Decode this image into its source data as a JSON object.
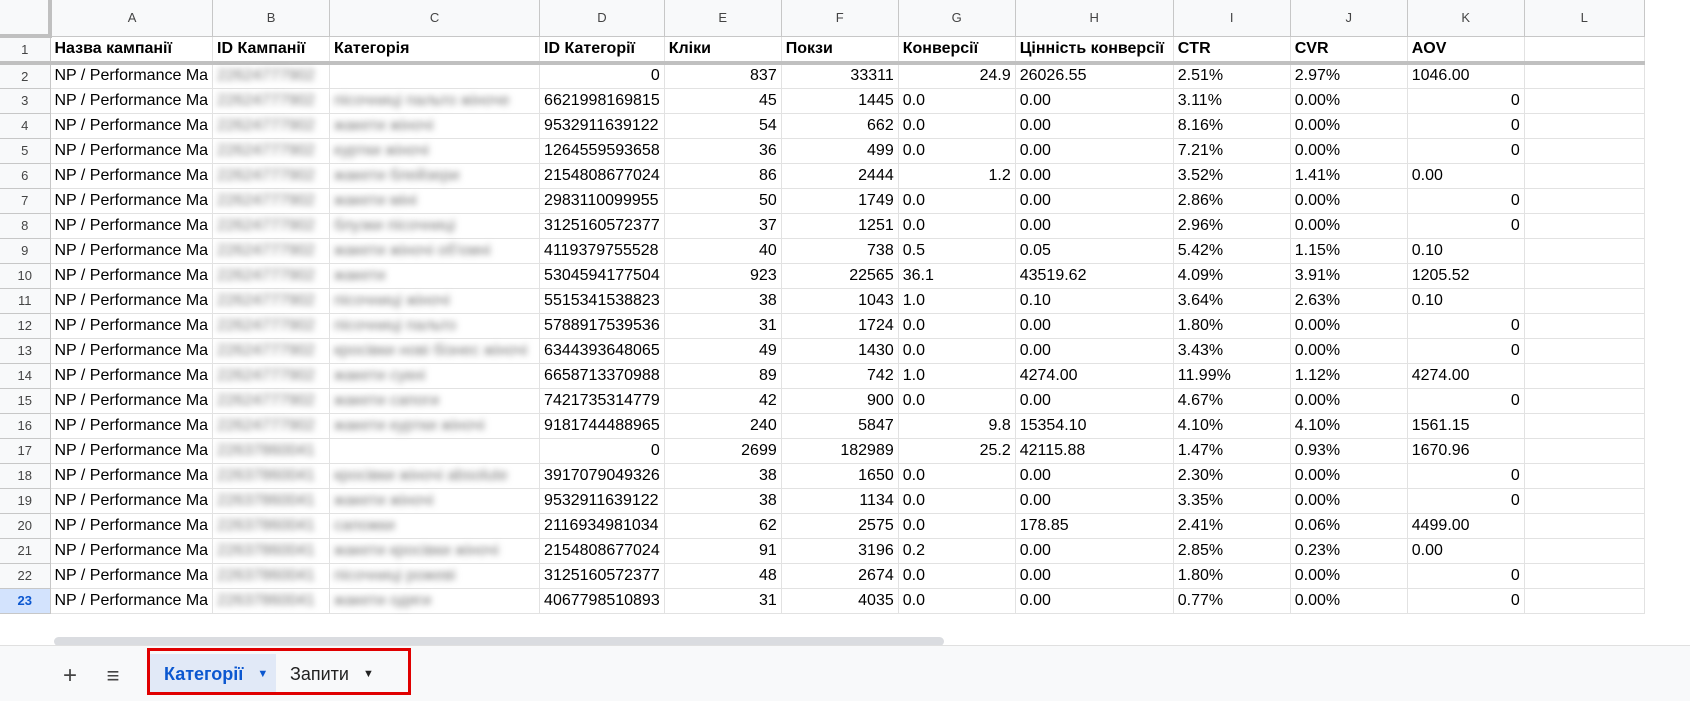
{
  "columns": [
    "A",
    "B",
    "C",
    "D",
    "E",
    "F",
    "G",
    "H",
    "I",
    "J",
    "K",
    "L"
  ],
  "headers": [
    "Назва кампанії",
    "ID Кампанії",
    "Категорія",
    "ID Категорії",
    "Кліки",
    "Покзи",
    "Конверсії",
    "Цінність конверсії",
    "CTR",
    "CVR",
    "AOV"
  ],
  "rows": [
    {
      "n": "2",
      "a": "NP / Performance Ma",
      "b": "22624777902",
      "c": "",
      "d": "0",
      "e": "837",
      "f": "33311",
      "g": "24.9",
      "g_align": "right",
      "h": "26026.55",
      "i": "2.51%",
      "j": "2.97%",
      "k": "1046.00",
      "k_align": "left"
    },
    {
      "n": "3",
      "a": "NP / Performance Ma",
      "b": "22624777902",
      "c": "пісочниці пальто жіноче",
      "d": "6621998169815",
      "e": "45",
      "f": "1445",
      "g": "0.0",
      "g_align": "left",
      "h": "0.00",
      "i": "3.11%",
      "j": "0.00%",
      "k": "0",
      "k_align": "right"
    },
    {
      "n": "4",
      "a": "NP / Performance Ma",
      "b": "22624777902",
      "c": "жакети жіночі",
      "d": "9532911639122",
      "e": "54",
      "f": "662",
      "g": "0.0",
      "g_align": "left",
      "h": "0.00",
      "i": "8.16%",
      "j": "0.00%",
      "k": "0",
      "k_align": "right"
    },
    {
      "n": "5",
      "a": "NP / Performance Ma",
      "b": "22624777902",
      "c": "куртки жіночі",
      "d": "1264559593658",
      "e": "36",
      "f": "499",
      "g": "0.0",
      "g_align": "left",
      "h": "0.00",
      "i": "7.21%",
      "j": "0.00%",
      "k": "0",
      "k_align": "right"
    },
    {
      "n": "6",
      "a": "NP / Performance Ma",
      "b": "22624777902",
      "c": "жакети блейзери",
      "d": "2154808677024",
      "e": "86",
      "f": "2444",
      "g": "1.2",
      "g_align": "right",
      "h": "0.00",
      "i": "3.52%",
      "j": "1.41%",
      "k": "0.00",
      "k_align": "left"
    },
    {
      "n": "7",
      "a": "NP / Performance Ma",
      "b": "22624777902",
      "c": "жакети міні",
      "d": "2983110099955",
      "e": "50",
      "f": "1749",
      "g": "0.0",
      "g_align": "left",
      "h": "0.00",
      "i": "2.86%",
      "j": "0.00%",
      "k": "0",
      "k_align": "right"
    },
    {
      "n": "8",
      "a": "NP / Performance Ma",
      "b": "22624777902",
      "c": "блузки пісочниці",
      "d": "3125160572377",
      "e": "37",
      "f": "1251",
      "g": "0.0",
      "g_align": "left",
      "h": "0.00",
      "i": "2.96%",
      "j": "0.00%",
      "k": "0",
      "k_align": "right"
    },
    {
      "n": "9",
      "a": "NP / Performance Ma",
      "b": "22624777902",
      "c": "жакети жіночі об'ємні",
      "d": "4119379755528",
      "e": "40",
      "f": "738",
      "g": "0.5",
      "g_align": "left",
      "h": "0.05",
      "i": "5.42%",
      "j": "1.15%",
      "k": "0.10",
      "k_align": "left"
    },
    {
      "n": "10",
      "a": "NP / Performance Ma",
      "b": "22624777902",
      "c": "жакети",
      "d": "5304594177504",
      "e": "923",
      "f": "22565",
      "g": "36.1",
      "g_align": "left",
      "h": "43519.62",
      "i": "4.09%",
      "j": "3.91%",
      "k": "1205.52",
      "k_align": "left"
    },
    {
      "n": "11",
      "a": "NP / Performance Ma",
      "b": "22624777902",
      "c": "пісочниці жіночі",
      "d": "5515341538823",
      "e": "38",
      "f": "1043",
      "g": "1.0",
      "g_align": "left",
      "h": "0.10",
      "i": "3.64%",
      "j": "2.63%",
      "k": "0.10",
      "k_align": "left"
    },
    {
      "n": "12",
      "a": "NP / Performance Ma",
      "b": "22624777902",
      "c": "пісочниці пальто",
      "d": "5788917539536",
      "e": "31",
      "f": "1724",
      "g": "0.0",
      "g_align": "left",
      "h": "0.00",
      "i": "1.80%",
      "j": "0.00%",
      "k": "0",
      "k_align": "right"
    },
    {
      "n": "13",
      "a": "NP / Performance Ma",
      "b": "22624777902",
      "c": "кросівки нові бізнес жіночі",
      "d": "6344393648065",
      "e": "49",
      "f": "1430",
      "g": "0.0",
      "g_align": "left",
      "h": "0.00",
      "i": "3.43%",
      "j": "0.00%",
      "k": "0",
      "k_align": "right"
    },
    {
      "n": "14",
      "a": "NP / Performance Ma",
      "b": "22624777902",
      "c": "жакети сукні",
      "d": "6658713370988",
      "e": "89",
      "f": "742",
      "g": "1.0",
      "g_align": "left",
      "h": "4274.00",
      "i": "11.99%",
      "j": "1.12%",
      "k": "4274.00",
      "k_align": "left"
    },
    {
      "n": "15",
      "a": "NP / Performance Ma",
      "b": "22624777902",
      "c": "жакети сапоги",
      "d": "7421735314779",
      "e": "42",
      "f": "900",
      "g": "0.0",
      "g_align": "left",
      "h": "0.00",
      "i": "4.67%",
      "j": "0.00%",
      "k": "0",
      "k_align": "right"
    },
    {
      "n": "16",
      "a": "NP / Performance Ma",
      "b": "22624777902",
      "c": "жакети куртки жіночі",
      "d": "9181744488965",
      "e": "240",
      "f": "5847",
      "g": "9.8",
      "g_align": "right",
      "h": "15354.10",
      "i": "4.10%",
      "j": "4.10%",
      "k": "1561.15",
      "k_align": "left"
    },
    {
      "n": "17",
      "a": "NP / Performance Ma",
      "b": "22637860041",
      "c": "",
      "d": "0",
      "e": "2699",
      "f": "182989",
      "g": "25.2",
      "g_align": "right",
      "h": "42115.88",
      "i": "1.47%",
      "j": "0.93%",
      "k": "1670.96",
      "k_align": "left"
    },
    {
      "n": "18",
      "a": "NP / Performance Ma",
      "b": "22637860041",
      "c": "кросівки жіночі absolute",
      "d": "3917079049326",
      "e": "38",
      "f": "1650",
      "g": "0.0",
      "g_align": "left",
      "h": "0.00",
      "i": "2.30%",
      "j": "0.00%",
      "k": "0",
      "k_align": "right"
    },
    {
      "n": "19",
      "a": "NP / Performance Ma",
      "b": "22637860041",
      "c": "жакети жіночі",
      "d": "9532911639122",
      "e": "38",
      "f": "1134",
      "g": "0.0",
      "g_align": "left",
      "h": "0.00",
      "i": "3.35%",
      "j": "0.00%",
      "k": "0",
      "k_align": "right"
    },
    {
      "n": "20",
      "a": "NP / Performance Ma",
      "b": "22637860041",
      "c": "сапожки",
      "d": "2116934981034",
      "e": "62",
      "f": "2575",
      "g": "0.0",
      "g_align": "left",
      "h": "178.85",
      "i": "2.41%",
      "j": "0.06%",
      "k": "4499.00",
      "k_align": "left"
    },
    {
      "n": "21",
      "a": "NP / Performance Ma",
      "b": "22637860041",
      "c": "жакети кросівки жіночі",
      "d": "2154808677024",
      "e": "91",
      "f": "3196",
      "g": "0.2",
      "g_align": "left",
      "h": "0.00",
      "i": "2.85%",
      "j": "0.23%",
      "k": "0.00",
      "k_align": "left"
    },
    {
      "n": "22",
      "a": "NP / Performance Ma",
      "b": "22637860041",
      "c": "пісочниці рожеві",
      "d": "3125160572377",
      "e": "48",
      "f": "2674",
      "g": "0.0",
      "g_align": "left",
      "h": "0.00",
      "i": "1.80%",
      "j": "0.00%",
      "k": "0",
      "k_align": "right"
    },
    {
      "n": "23",
      "a": "NP / Performance Ma",
      "b": "22637860041",
      "c": "жакети одяги",
      "d": "4067798510893",
      "e": "31",
      "f": "4035",
      "g": "0.0",
      "g_align": "left",
      "h": "0.00",
      "i": "0.77%",
      "j": "0.00%",
      "k": "0",
      "k_align": "right"
    }
  ],
  "active_row": "23",
  "tabs": {
    "add_icon": "plus-icon",
    "menu_icon": "hamburger-menu-icon",
    "items": [
      {
        "label": "Категорії",
        "active": true
      },
      {
        "label": "Запити",
        "active": false
      }
    ]
  },
  "colors": {
    "active_tab_text": "#0b57d0",
    "active_tab_bg": "#e1e9f7",
    "highlight": "#e00000"
  }
}
